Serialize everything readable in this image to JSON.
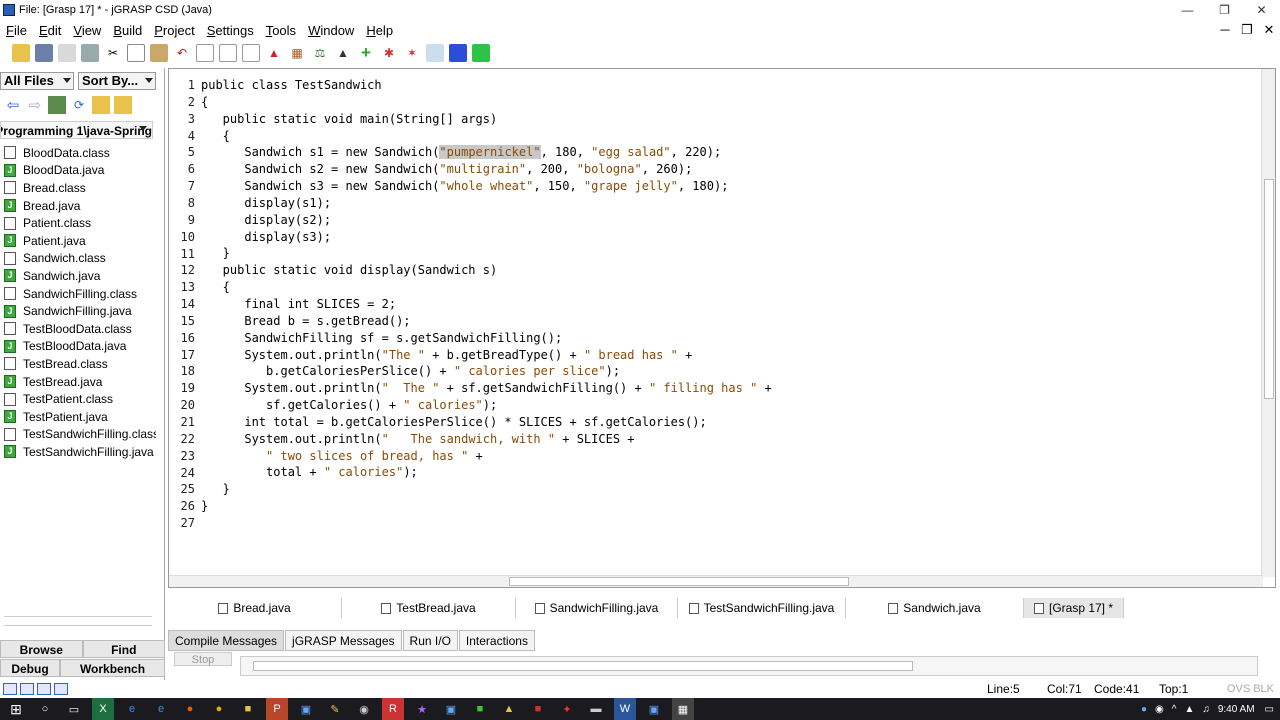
{
  "window": {
    "title": "File: [Grasp 17] * - jGRASP CSD (Java)"
  },
  "menu": [
    {
      "pre": "",
      "u": "F",
      "post": "ile"
    },
    {
      "pre": "",
      "u": "E",
      "post": "dit"
    },
    {
      "pre": "",
      "u": "V",
      "post": "iew"
    },
    {
      "pre": "",
      "u": "B",
      "post": "uild"
    },
    {
      "pre": "",
      "u": "P",
      "post": "roject"
    },
    {
      "pre": "",
      "u": "S",
      "post": "ettings"
    },
    {
      "pre": "",
      "u": "T",
      "post": "ools"
    },
    {
      "pre": "",
      "u": "W",
      "post": "indow"
    },
    {
      "pre": "",
      "u": "H",
      "post": "elp"
    }
  ],
  "left": {
    "filter": "All Files",
    "sort": "Sort By...",
    "path": "Programming 1\\java-Spring",
    "files": [
      {
        "name": "BloodData.class",
        "type": "class"
      },
      {
        "name": "BloodData.java",
        "type": "java"
      },
      {
        "name": "Bread.class",
        "type": "class"
      },
      {
        "name": "Bread.java",
        "type": "java"
      },
      {
        "name": "Patient.class",
        "type": "class"
      },
      {
        "name": "Patient.java",
        "type": "java"
      },
      {
        "name": "Sandwich.class",
        "type": "class"
      },
      {
        "name": "Sandwich.java",
        "type": "java"
      },
      {
        "name": "SandwichFilling.class",
        "type": "class"
      },
      {
        "name": "SandwichFilling.java",
        "type": "java"
      },
      {
        "name": "TestBloodData.class",
        "type": "class"
      },
      {
        "name": "TestBloodData.java",
        "type": "java"
      },
      {
        "name": "TestBread.class",
        "type": "class"
      },
      {
        "name": "TestBread.java",
        "type": "java"
      },
      {
        "name": "TestPatient.class",
        "type": "class"
      },
      {
        "name": "TestPatient.java",
        "type": "java"
      },
      {
        "name": "TestSandwichFilling.class",
        "type": "class"
      },
      {
        "name": "TestSandwichFilling.java",
        "type": "java"
      }
    ],
    "tabs": {
      "browse": "Browse",
      "find": "Find",
      "debug": "Debug",
      "workbench": "Workbench"
    }
  },
  "editor": {
    "lines": [
      "public class TestSandwich",
      "{",
      "   public static void main(String[] args)",
      "   {",
      "      Sandwich s1 = new Sandwich(\"pumpernickel\", 180, \"egg salad\", 220);",
      "      Sandwich s2 = new Sandwich(\"multigrain\", 200, \"bologna\", 260);",
      "      Sandwich s3 = new Sandwich(\"whole wheat\", 150, \"grape jelly\", 180);",
      "      display(s1);",
      "      display(s2);",
      "      display(s3);",
      "   }",
      "   public static void display(Sandwich s)",
      "   {",
      "      final int SLICES = 2;",
      "      Bread b = s.getBread();",
      "      SandwichFilling sf = s.getSandwichFilling();",
      "      System.out.println(\"The \" + b.getBreadType() + \" bread has \" +",
      "         b.getCaloriesPerSlice() + \" calories per slice\");",
      "      System.out.println(\"  The \" + sf.getSandwichFilling() + \" filling has \" +",
      "         sf.getCalories() + \" calories\");",
      "      int total = b.getCaloriesPerSlice() * SLICES + sf.getCalories();",
      "      System.out.println(\"   The sandwich, with \" + SLICES +",
      "         \" two slices of bread, has \" +",
      "         total + \" calories\");",
      "   }",
      "}",
      ""
    ]
  },
  "file_tabs": [
    {
      "name": "Bread.java",
      "active": false
    },
    {
      "name": "TestBread.java",
      "active": false
    },
    {
      "name": "SandwichFilling.java",
      "active": false
    },
    {
      "name": "TestSandwichFilling.java",
      "active": false
    },
    {
      "name": "Sandwich.java",
      "active": false
    },
    {
      "name": "[Grasp 17] *",
      "active": true
    }
  ],
  "bottom_tabs": [
    "Compile Messages",
    "jGRASP Messages",
    "Run I/O",
    "Interactions"
  ],
  "stop_label": "Stop",
  "status": {
    "line": "Line:5",
    "col": "Col:71",
    "code": "Code:41",
    "top": "Top:1",
    "ovs": "OVS BLK"
  },
  "taskbar": {
    "time": "9:40 AM"
  }
}
